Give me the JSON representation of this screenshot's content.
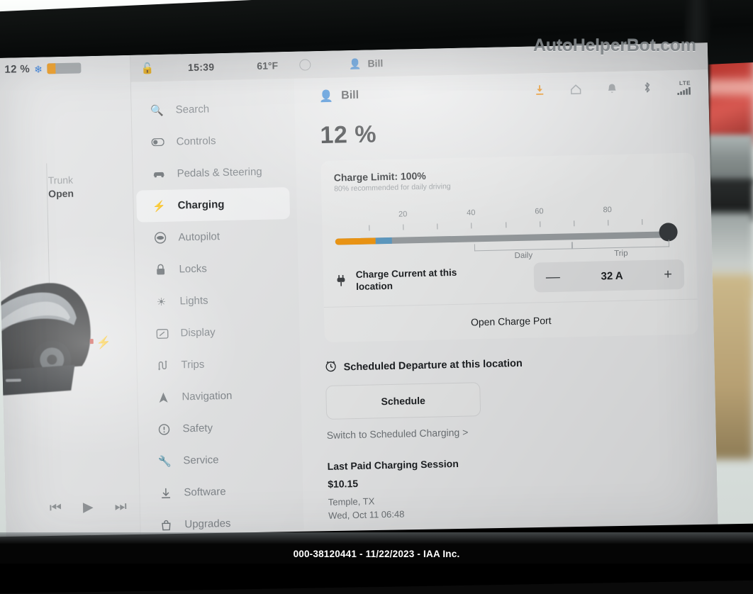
{
  "watermark": "AutoHelperBot.com",
  "footer": "000-38120441 - 11/22/2023 - IAA Inc.",
  "left_panel": {
    "battery_percent": "12 %",
    "battery_icon": "snowflake-icon",
    "battery_fill_color": "#f2960d",
    "trunk_title": "Trunk",
    "trunk_state": "Open",
    "media": {
      "previous": "⏮",
      "play": "▶",
      "next": "⏭"
    }
  },
  "status_bar": {
    "lock_icon": "unlocked-padlock-icon",
    "time": "15:39",
    "temperature": "61°F",
    "fan_icon": "fan-dial-icon",
    "user": "Bill"
  },
  "sidebar": {
    "items": [
      {
        "label": "Search",
        "icon": "search-icon",
        "active": false
      },
      {
        "label": "Controls",
        "icon": "toggle-icon",
        "active": false
      },
      {
        "label": "Pedals & Steering",
        "icon": "car-icon",
        "active": false
      },
      {
        "label": "Charging",
        "icon": "lightning-bolt-icon",
        "active": true
      },
      {
        "label": "Autopilot",
        "icon": "steering-wheel-icon",
        "active": false
      },
      {
        "label": "Locks",
        "icon": "padlock-icon",
        "active": false
      },
      {
        "label": "Lights",
        "icon": "sun-icon",
        "active": false
      },
      {
        "label": "Display",
        "icon": "display-icon",
        "active": false
      },
      {
        "label": "Trips",
        "icon": "trips-icon",
        "active": false
      },
      {
        "label": "Navigation",
        "icon": "navigation-arrow-icon",
        "active": false
      },
      {
        "label": "Safety",
        "icon": "warning-circle-icon",
        "active": false
      },
      {
        "label": "Service",
        "icon": "wrench-icon",
        "active": false
      },
      {
        "label": "Software",
        "icon": "download-icon",
        "active": false
      },
      {
        "label": "Upgrades",
        "icon": "bag-icon",
        "active": false
      }
    ]
  },
  "main": {
    "profile": "Bill",
    "status_icons": [
      {
        "name": "download-arrow-icon",
        "glyph": "⬇",
        "color": "#ef8f13"
      },
      {
        "name": "home-icon",
        "glyph": "⌂",
        "color": "#9ba0a4"
      },
      {
        "name": "bell-icon",
        "glyph": "🔔",
        "color": "#9ba0a4"
      },
      {
        "name": "bluetooth-icon",
        "glyph": "ᛦ",
        "color": "#9ba0a4"
      },
      {
        "name": "lte-signal-icon",
        "glyph": "LTE",
        "color": "#6f7478"
      }
    ],
    "battery_percent": "12 %",
    "charge_limit": {
      "title": "Charge Limit: 100%",
      "subtitle": "80% recommended for daily driving",
      "value": 100,
      "current_charge": 12,
      "tick_numbers": [
        "20",
        "40",
        "60",
        "80"
      ],
      "range_labels": {
        "daily": "Daily",
        "trip": "Trip"
      },
      "handle_color": "#3a3d40",
      "charge_color": "#f2960d",
      "blue_color": "#5d9bc4"
    },
    "charge_current": {
      "icon": "plug-icon",
      "label": "Charge Current at this location",
      "minus": "—",
      "value": "32 A",
      "plus": "+"
    },
    "open_charge_port": "Open Charge Port",
    "scheduled_departure": {
      "icon": "clock-icon",
      "heading": "Scheduled Departure at this location",
      "button": "Schedule",
      "switch_link": "Switch to Scheduled Charging >"
    },
    "last_session": {
      "title": "Last Paid Charging Session",
      "amount": "$10.15",
      "location": "Temple, TX",
      "datetime": "Wed, Oct 11 06:48"
    }
  }
}
